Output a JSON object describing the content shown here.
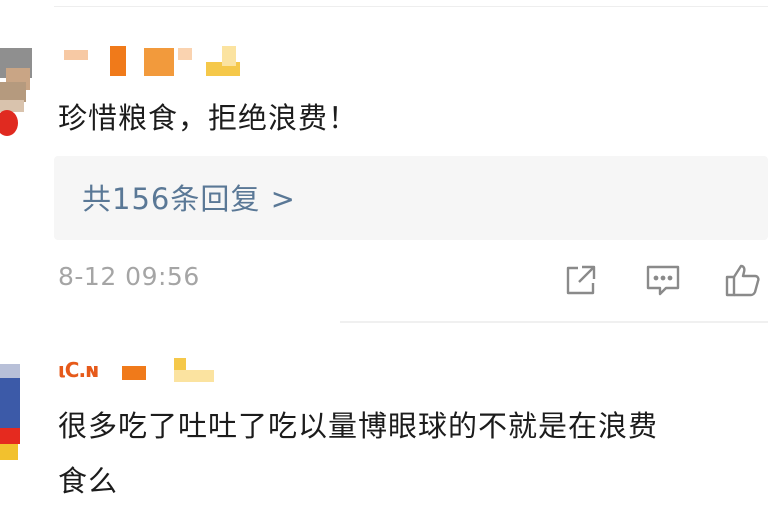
{
  "comments": [
    {
      "text": "珍惜粮食，拒绝浪费！",
      "replies_label": "共156条回复 >",
      "timestamp": "8-12 09:56",
      "actions": [
        {
          "icon": "share-icon"
        },
        {
          "icon": "comment-icon"
        },
        {
          "icon": "like-icon"
        }
      ]
    },
    {
      "name_partial": "ιC.ɴ",
      "text_line1": "很多吃了吐吐了吃以量博眼球的不就是在浪费",
      "text_line2": "食么"
    }
  ],
  "colors": {
    "reply_link": "#5a7896",
    "timestamp": "#a5a5a5",
    "reply_bg": "#f6f6f6",
    "name_orange": "#f08a2a",
    "name_yellow": "#f5c84a"
  }
}
